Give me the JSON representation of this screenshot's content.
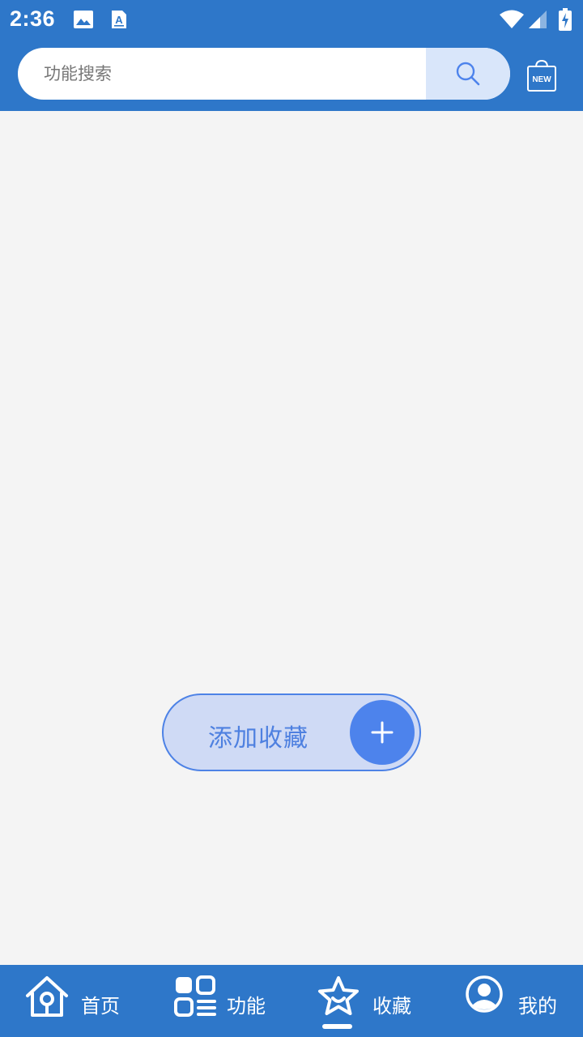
{
  "status_bar": {
    "time": "2:36",
    "icons": [
      "image-icon",
      "text-a-icon",
      "wifi-icon",
      "signal-icon",
      "battery-charging-icon"
    ]
  },
  "header": {
    "search": {
      "placeholder": "功能搜索",
      "value": "",
      "button_icon": "search-icon"
    },
    "new_badge": "NEW"
  },
  "main": {
    "add_favorite": {
      "label": "添加收藏",
      "icon": "plus-icon"
    }
  },
  "tabbar": {
    "active_index": 2,
    "tabs": [
      {
        "label": "首页",
        "icon": "home-icon"
      },
      {
        "label": "功能",
        "icon": "grid-icon"
      },
      {
        "label": "收藏",
        "icon": "star-icon"
      },
      {
        "label": "我的",
        "icon": "user-icon"
      }
    ]
  },
  "colors": {
    "primary": "#2e77c9",
    "background": "#f4f4f4",
    "accent": "#4d83ec",
    "search_button_bg": "#d9e6fa",
    "add_pill_bg": "#cfdaf5"
  }
}
